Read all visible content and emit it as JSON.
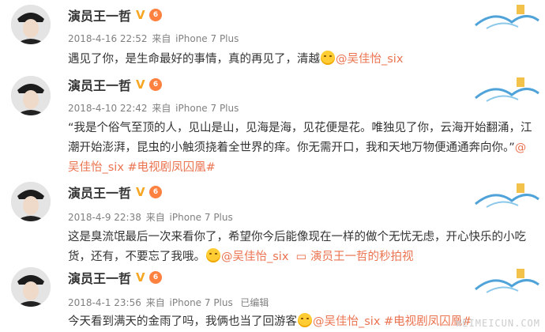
{
  "posts": [
    {
      "name": "演员王一哲",
      "meta_date": "2018-4-16 22:52",
      "meta_from": "来自",
      "meta_device": "iPhone 7 Plus",
      "text_plain": "遇见了你，是生命最好的事情，真的再见了，清越",
      "mention": "@吴佳怡_six"
    },
    {
      "name": "演员王一哲",
      "meta_date": "2018-4-10 22:42",
      "meta_from": "来自",
      "meta_device": "iPhone 7 Plus",
      "text_plain": "“我是个俗气至顶的人，见山是山，见海是海，见花便是花。唯独见了你，云海开始翻涌，江潮开始澎湃，昆虫的小触须挠着全世界的痒。你无需开口，我和天地万物便通通奔向你。”",
      "mention": "@吴佳怡_six",
      "topic": "#电视剧凤囚凰#"
    },
    {
      "name": "演员王一哲",
      "meta_date": "2018-4-9 22:38",
      "meta_from": "来自",
      "meta_device": "iPhone 7 Plus",
      "text_plain": "这是臭流氓最后一次来看你了，希望你今后能像现在一样的做个无忧无虑，开心快乐的小吃货，还有，不要忘了我哦。",
      "mention": "@吴佳怡_six",
      "video": "演员王一哲的秒拍视"
    },
    {
      "name": "演员王一哲",
      "meta_date": "2018-4-1 23:56",
      "meta_from": "来自",
      "meta_device": "iPhone 7 Plus",
      "meta_edited": "已编辑",
      "text_plain": "今天看到满天的金雨了吗，我俩也当了回游客",
      "mention": "@吴佳怡_six",
      "topic": "#电视剧凤囚凰#"
    }
  ],
  "watermark": "WEIMEICUN.COM",
  "colors": {
    "link": "#eb7350",
    "meta": "#808080",
    "text": "#333333",
    "vbadge": "#f5a623"
  },
  "icons": [
    "avatar",
    "verified-v-icon",
    "vip-badge-icon",
    "smile-emoji-icon",
    "video-icon",
    "card-decoration-icon"
  ]
}
